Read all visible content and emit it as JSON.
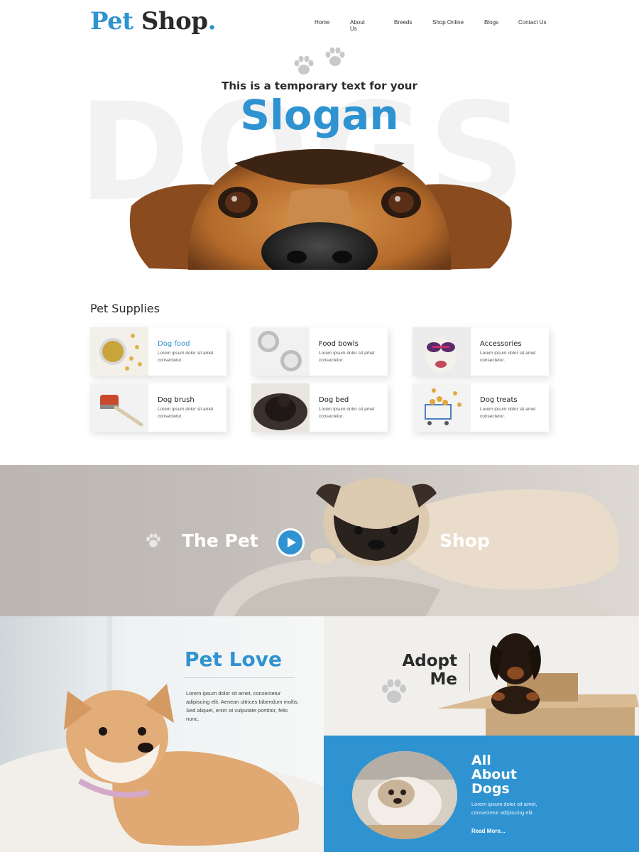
{
  "header": {
    "logo_pet": "Pet",
    "logo_shop": "Shop",
    "logo_dot": ".",
    "nav": [
      "Home",
      "About Us",
      "Breeds",
      "Shop Online",
      "Blogs",
      "Contact Us"
    ]
  },
  "hero": {
    "background_word": "DOGS",
    "tagline": "This is a temporary text for your",
    "slogan": "Slogan"
  },
  "supplies": {
    "title": "Pet Supplies",
    "items": [
      {
        "title": "Dog food",
        "text": "Lorem ipsum dolor sit amet consectetur.",
        "highlight": true
      },
      {
        "title": "Food bowls",
        "text": "Lorem ipsum dolor sit amet consectetur.",
        "highlight": false
      },
      {
        "title": "Accessories",
        "text": "Lorem ipsum dolor sit amet consectetur.",
        "highlight": false
      },
      {
        "title": "Dog brush",
        "text": "Lorem ipsum dolor sit amet consectetur.",
        "highlight": false
      },
      {
        "title": "Dog bed",
        "text": "Lorem ipsum dolor sit amet consectetur.",
        "highlight": false
      },
      {
        "title": "Dog treats",
        "text": "Lorem ipsum dolor sit amet consectetur.",
        "highlight": false
      }
    ]
  },
  "banner": {
    "left_text": "The Pet",
    "right_text": "Shop"
  },
  "love": {
    "title": "Pet Love",
    "text": "Lorem ipsum dolor sit amet, consectetur adipiscing elit. Aenean ultrices bibendum mollis. Sed aliquet, enim at vulputate porttitor, felis nunc."
  },
  "adopt": {
    "line1": "Adopt",
    "line2": "Me"
  },
  "about": {
    "line1": "All",
    "line2": "About",
    "line3": "Dogs",
    "text": "Lorem ipsum dolor sit amet, consectetur adipiscing elit.",
    "link": "Read More..."
  },
  "colors": {
    "accent": "#2f93d1",
    "dark": "#2a2a2a",
    "banner_bg": "#bdb8b4"
  }
}
